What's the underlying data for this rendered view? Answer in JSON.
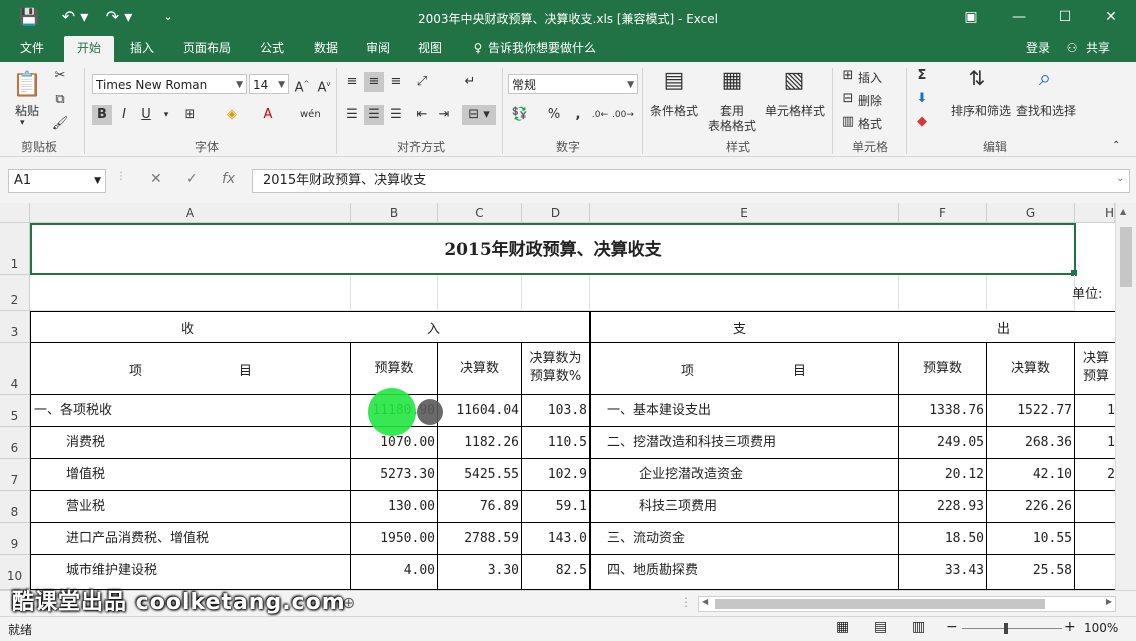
{
  "window": {
    "title": "2003年中央财政预算、决算收支.xls  [兼容模式] - Excel",
    "controls": [
      "▣",
      "—",
      "☐",
      "✕"
    ]
  },
  "menu": {
    "tabs": [
      "文件",
      "开始",
      "插入",
      "页面布局",
      "公式",
      "数据",
      "审阅",
      "视图"
    ],
    "active": "开始",
    "tell_me": "告诉我你想要做什么",
    "login": "登录",
    "share": "共享"
  },
  "ribbon": {
    "clipboard": {
      "paste": "粘贴",
      "label": "剪贴板"
    },
    "font": {
      "name": "Times New Roman",
      "size": "14",
      "label": "字体",
      "bold": "B",
      "italic": "I",
      "underline": "U"
    },
    "alignment": {
      "label": "对齐方式"
    },
    "number": {
      "format": "常规",
      "label": "数字"
    },
    "styles": {
      "cond": "条件格式",
      "table1": "套用",
      "table2": "表格格式",
      "cellstyle": "单元格样式",
      "label": "样式"
    },
    "cells": {
      "insert": "插入",
      "delete": "删除",
      "format": "格式",
      "label": "单元格"
    },
    "editing": {
      "sort": "排序和筛选",
      "find": "查找和选择",
      "label": "编辑"
    }
  },
  "formula_bar": {
    "name_box": "A1",
    "fx": "fx",
    "content": "2015年财政预算、决算收支"
  },
  "columns": [
    "A",
    "B",
    "C",
    "D",
    "E",
    "F",
    "G",
    "H"
  ],
  "rows": [
    "1",
    "2",
    "3",
    "4",
    "5",
    "6",
    "7",
    "8",
    "9",
    "10"
  ],
  "sheet": {
    "title": "2015年财政预算、决算收支",
    "unit": "单位:",
    "r3": {
      "left1": "收",
      "left2": "入",
      "right1": "支",
      "right2": "出"
    },
    "r4": {
      "item_a": "项",
      "item_b": "目",
      "budget": "预算数",
      "actual": "决算数",
      "pct1": "决算数为",
      "pct2": "预算数%",
      "item2_a": "项",
      "item2_b": "目",
      "budget2": "预算数",
      "actual2": "决算数",
      "pct2_1": "决算",
      "pct2_2": "预算"
    },
    "data": [
      {
        "a": "一、各项税收",
        "b": "11180.90",
        "c": "11604.04",
        "d": "103.8",
        "e": "一、基本建设支出",
        "f": "1338.76",
        "g": "1522.77",
        "h": "1"
      },
      {
        "a": "消费税",
        "b": "1070.00",
        "c": "1182.26",
        "d": "110.5",
        "e": "二、挖潜改造和科技三项费用",
        "f": "249.05",
        "g": "268.36",
        "h": "1"
      },
      {
        "a": "增值税",
        "b": "5273.30",
        "c": "5425.55",
        "d": "102.9",
        "e": "企业挖潜改造资金",
        "f": "20.12",
        "g": "42.10",
        "h": "2"
      },
      {
        "a": "营业税",
        "b": "130.00",
        "c": "76.89",
        "d": "59.1",
        "e": "科技三项费用",
        "f": "228.93",
        "g": "226.26",
        "h": ""
      },
      {
        "a": "进口产品消费税、增值税",
        "b": "1950.00",
        "c": "2788.59",
        "d": "143.0",
        "e": "三、流动资金",
        "f": "18.50",
        "g": "10.55",
        "h": ""
      },
      {
        "a": "城市维护建设税",
        "b": "4.00",
        "c": "3.30",
        "d": "82.5",
        "e": "四、地质勘探费",
        "f": "33.43",
        "g": "25.58",
        "h": ""
      }
    ]
  },
  "status": {
    "ready": "就绪",
    "zoom": "100%"
  },
  "watermark": "酷课堂出品 coolketang.com"
}
